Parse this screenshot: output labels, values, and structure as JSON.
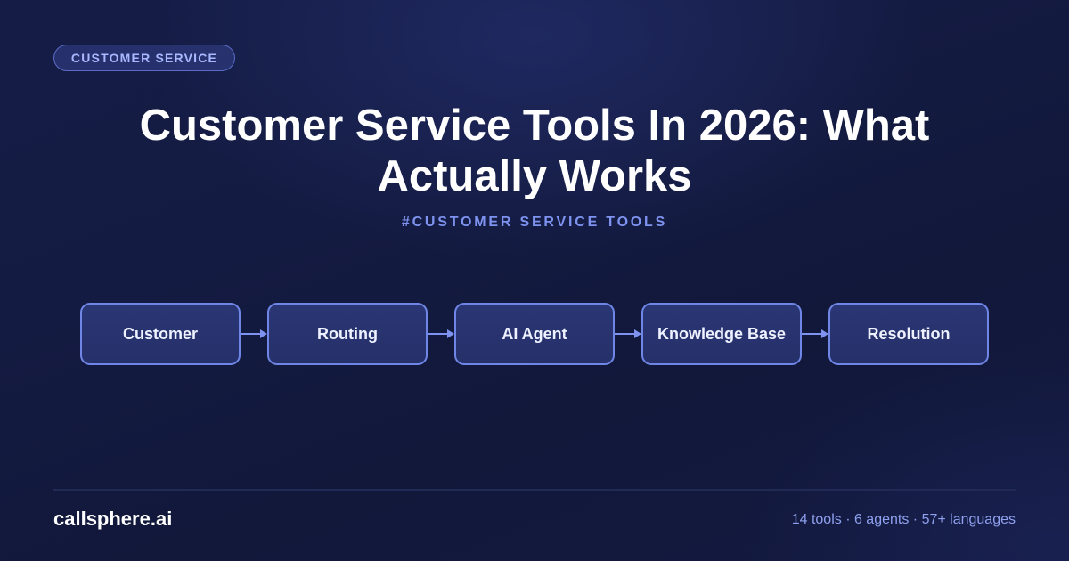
{
  "badge": {
    "label": "CUSTOMER SERVICE"
  },
  "title": "Customer Service Tools In 2026: What Actually Works",
  "hashtag": "#CUSTOMER SERVICE TOOLS",
  "flow": {
    "nodes": [
      {
        "label": "Customer"
      },
      {
        "label": "Routing"
      },
      {
        "label": "AI Agent"
      },
      {
        "label": "Knowledge Base"
      },
      {
        "label": "Resolution"
      }
    ]
  },
  "footer": {
    "brand": "callsphere.ai",
    "stats": "14 tools · 6 agents · 57+ languages"
  },
  "colors": {
    "background": "#141b42",
    "accent": "#7e93f0",
    "node_border": "#6f86e6",
    "node_fill": "#283370",
    "arrow": "#7e93f0"
  }
}
